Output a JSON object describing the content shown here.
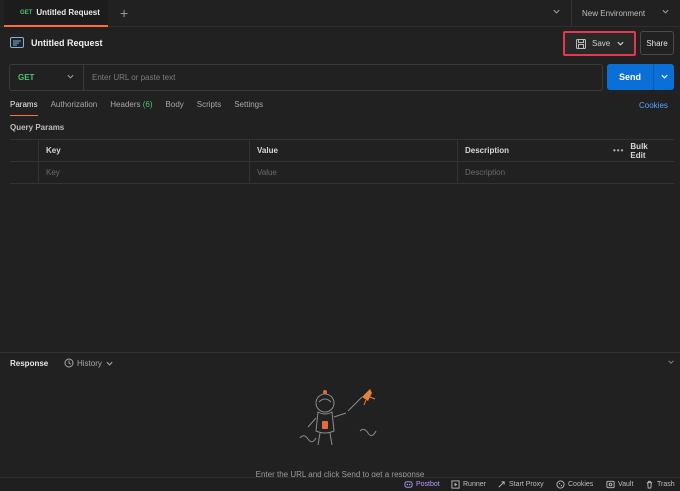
{
  "tab": {
    "method": "GET",
    "title": "Untitled Request"
  },
  "environment": {
    "label": "New Environment"
  },
  "request": {
    "title": "Untitled Request",
    "save_label": "Save",
    "share_label": "Share",
    "method": "GET",
    "url_placeholder": "Enter URL or paste text",
    "send_label": "Send"
  },
  "tabs": {
    "params": "Params",
    "authorization": "Authorization",
    "headers": "Headers",
    "headers_count": "(6)",
    "body": "Body",
    "scripts": "Scripts",
    "settings": "Settings",
    "cookies": "Cookies"
  },
  "query_params": {
    "label": "Query Params",
    "columns": [
      "Key",
      "Value",
      "Description"
    ],
    "bulk_edit": "Bulk Edit",
    "row_placeholders": [
      "Key",
      "Value",
      "Description"
    ]
  },
  "response": {
    "title": "Response",
    "history": "History",
    "hint": "Enter the URL and click Send to get a response"
  },
  "statusbar": {
    "postbot": "Postbot",
    "runner": "Runner",
    "start_proxy": "Start Proxy",
    "cookies": "Cookies",
    "vault": "Vault",
    "trash": "Trash"
  },
  "colors": {
    "accent_orange": "#ff6c37",
    "send_blue": "#0a6fd6",
    "get_green": "#4fc36e",
    "save_highlight": "#e2394f",
    "link_blue": "#4ea6ff"
  }
}
